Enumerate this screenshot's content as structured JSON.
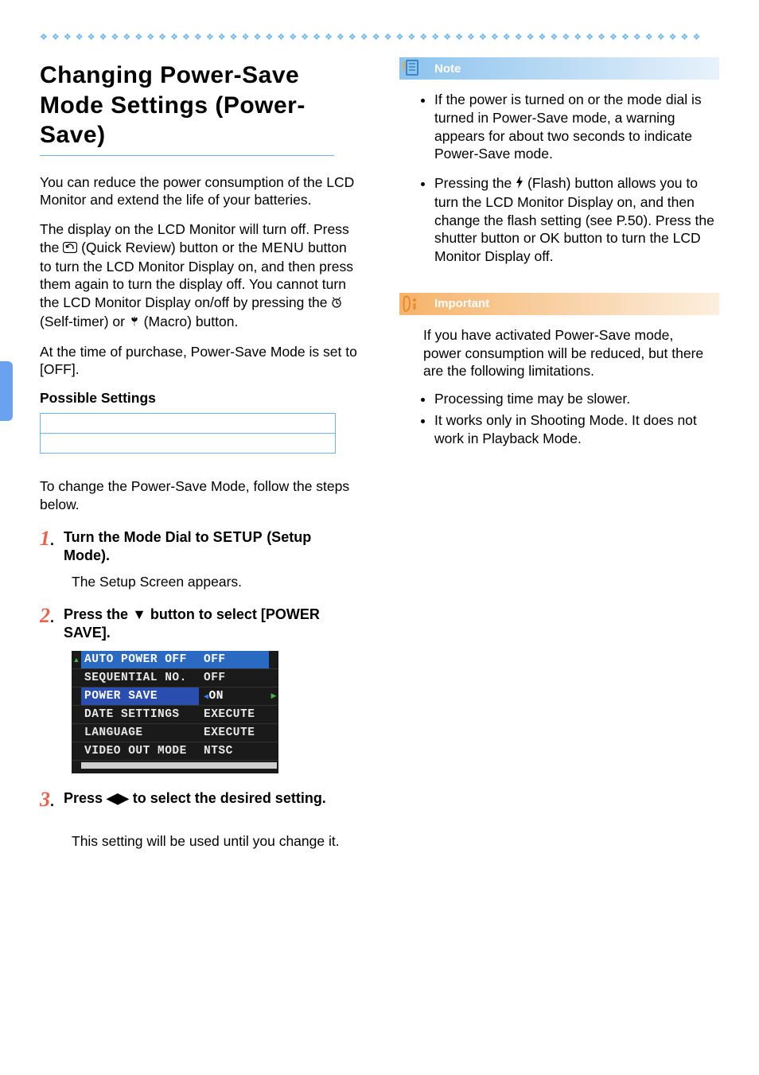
{
  "title": "Changing Power-Save Mode Settings (Power-Save)",
  "intro_p1": "You can reduce the power consumption of the LCD Monitor and extend the life of your batteries.",
  "intro_p2_before_icon": "The display on the LCD Monitor will turn off. Press the ",
  "intro_p2_after_icon": " (Quick Review) button or the ",
  "intro_p2_menu": "MENU",
  "intro_p2_mid": " button to turn the LCD Monitor Display on, and then press them again to turn the display off. You cannot turn the LCD Monitor Display on/off by pressing the ",
  "intro_p2_self": " (Self-timer) or ",
  "intro_p2_macro": " (Macro) button.",
  "intro_p3": "At the time of purchase, Power-Save Mode is set to [OFF].",
  "possible_heading": "Possible Settings",
  "intro_change": "To change the Power-Save Mode, follow the steps below.",
  "steps": {
    "s1_num": "1",
    "s1_head_before": "Turn the Mode Dial to ",
    "s1_head_setup": "SETUP",
    "s1_head_after": " (Setup Mode).",
    "s1_sub": "The Setup Screen appears.",
    "s2_num": "2",
    "s2_head_before": "Press the ",
    "s2_head_after": " button to select [POWER SAVE].",
    "s3_num": "3",
    "s3_head_before": "Press ",
    "s3_head_after": " to select the desired setting.",
    "s3_sub": "This setting will be used until you change it."
  },
  "lcd": {
    "rows": [
      {
        "label": "AUTO POWER OFF",
        "value": "OFF"
      },
      {
        "label": "SEQUENTIAL NO.",
        "value": "OFF"
      },
      {
        "label": "POWER SAVE",
        "value": "ON"
      },
      {
        "label": "DATE SETTINGS",
        "value": "EXECUTE"
      },
      {
        "label": "LANGUAGE",
        "value": "EXECUTE"
      },
      {
        "label": "VIDEO OUT MODE",
        "value": "NTSC"
      }
    ]
  },
  "note": {
    "title": "Note",
    "bullet1": "If the power is turned on or the mode dial is turned in Power-Save mode, a warning appears for about two seconds to indicate Power-Save mode.",
    "bullet2_before": "Pressing the ",
    "bullet2_after": " (Flash) button allows you to turn the LCD Monitor Display on, and then change the flash setting (see P.50). Press the shutter button or OK button to turn the LCD Monitor Display off."
  },
  "important": {
    "title": "Important",
    "intro": "If you have activated Power-Save mode, power consumption will be reduced, but there are the following limitations.",
    "bullet1": "Processing time may be slower.",
    "bullet2": "It works only in Shooting Mode. It does not work in Playback Mode."
  }
}
